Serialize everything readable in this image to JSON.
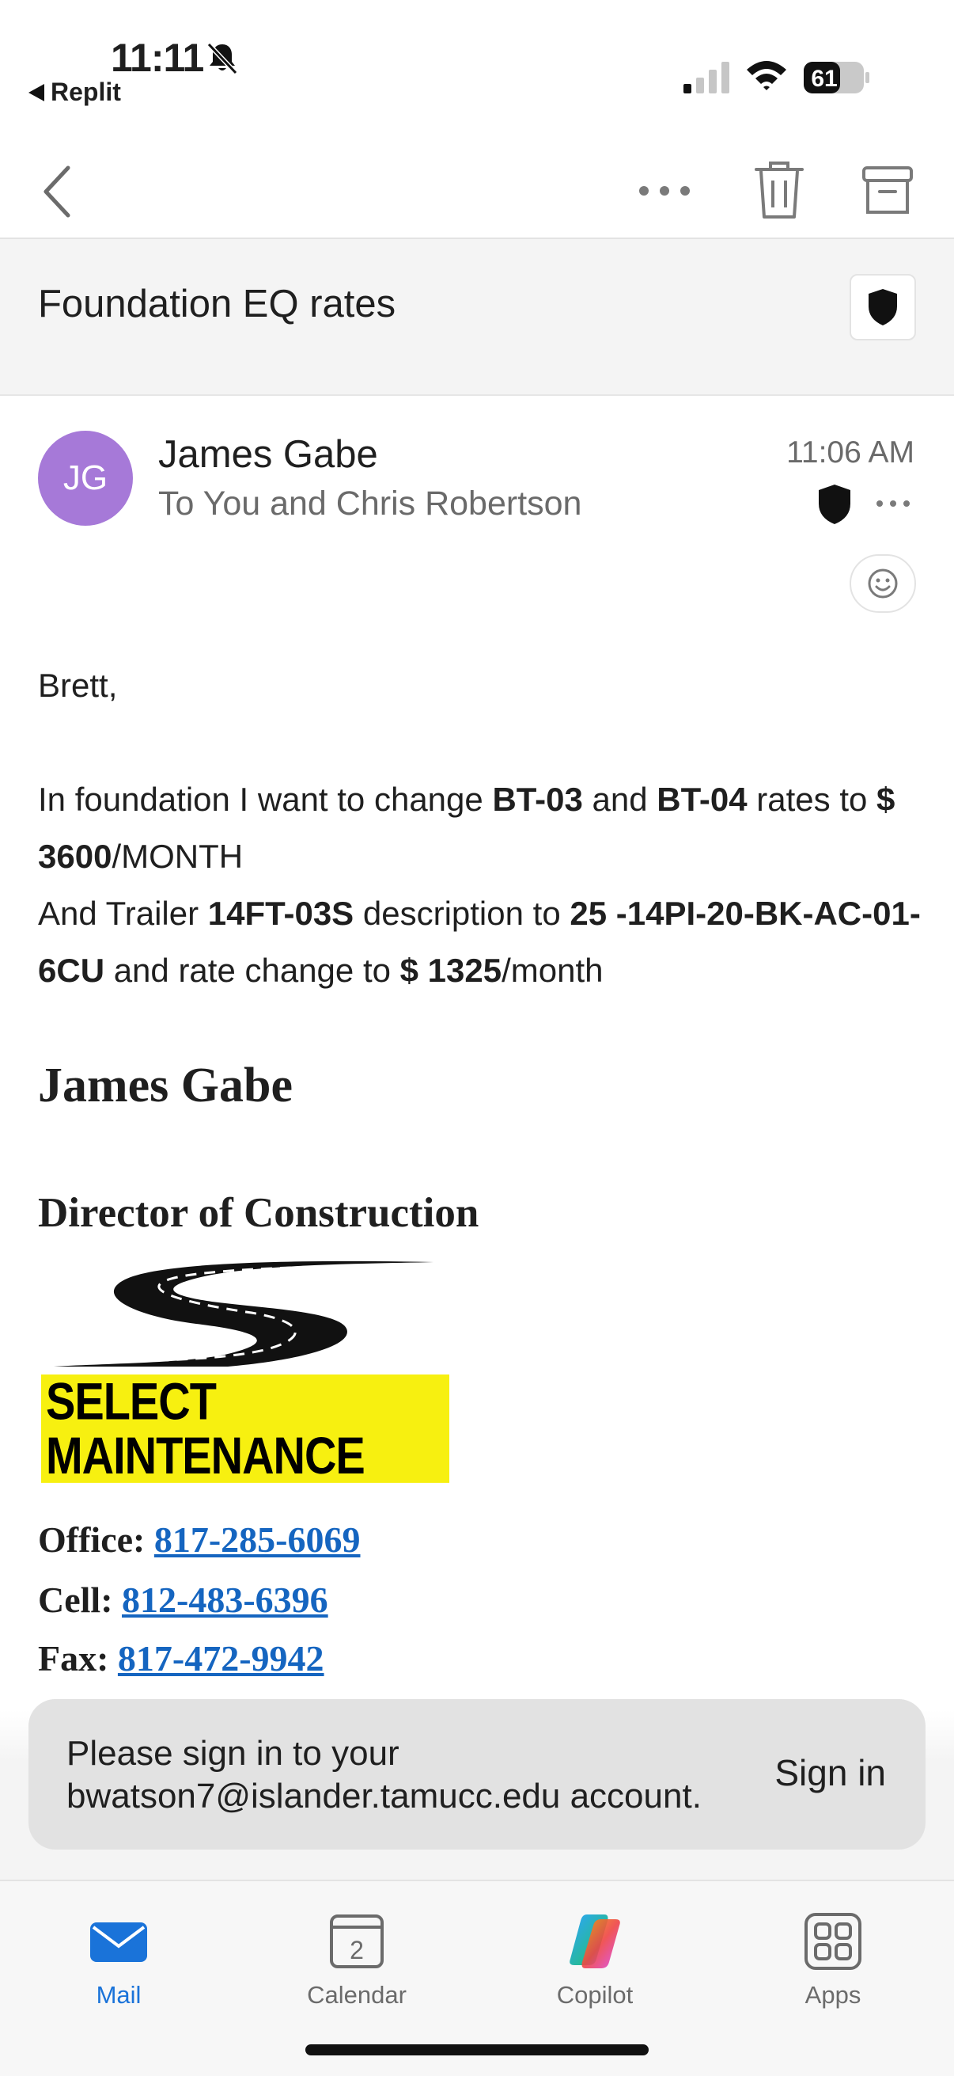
{
  "status_bar": {
    "time": "11:11",
    "back_app": "Replit",
    "battery": "61"
  },
  "header": {
    "subject": "Foundation EQ rates"
  },
  "message": {
    "avatar_initials": "JG",
    "sender": "James Gabe",
    "recipients": "To You and Chris Robertson",
    "time": "11:06 AM",
    "avatar_color": "#a679d8"
  },
  "body": {
    "greeting": "Brett,",
    "line1_a": "In foundation I want to change ",
    "line1_b1": "BT-03",
    "line1_c": " and ",
    "line1_b2": "BT-04",
    "line1_d": " rates to ",
    "line1_b3": "$ 3600",
    "line1_e": "/MONTH",
    "line2_a": "And Trailer ",
    "line2_b1": "14FT-03S",
    "line2_c": " description to ",
    "line2_b2": "25 -14PI-20-BK-AC-01-6CU",
    "line2_d": " and rate change to ",
    "line2_b3": "$ 1325",
    "line2_e": "/month"
  },
  "signature": {
    "name": "James Gabe",
    "title": "Director of Construction",
    "logo_text": "SELECT MAINTENANCE",
    "office_label": "Office: ",
    "office": "817-285-6069",
    "cell_label": "Cell: ",
    "cell": "812-483-6396",
    "fax_label": "Fax: ",
    "fax": "817-472-9942"
  },
  "banner": {
    "message": "Please sign in to your bwatson7@islander.tamucc.edu account.",
    "action": "Sign in"
  },
  "tabs": [
    {
      "label": "Mail",
      "icon": "mail-icon",
      "active": true
    },
    {
      "label": "Calendar",
      "icon": "calendar-icon",
      "badge": "2"
    },
    {
      "label": "Copilot",
      "icon": "copilot-icon"
    },
    {
      "label": "Apps",
      "icon": "apps-grid-icon"
    }
  ],
  "colors": {
    "accent": "#1a73d9",
    "link": "#1565c0",
    "logo_highlight": "#f7f010"
  }
}
